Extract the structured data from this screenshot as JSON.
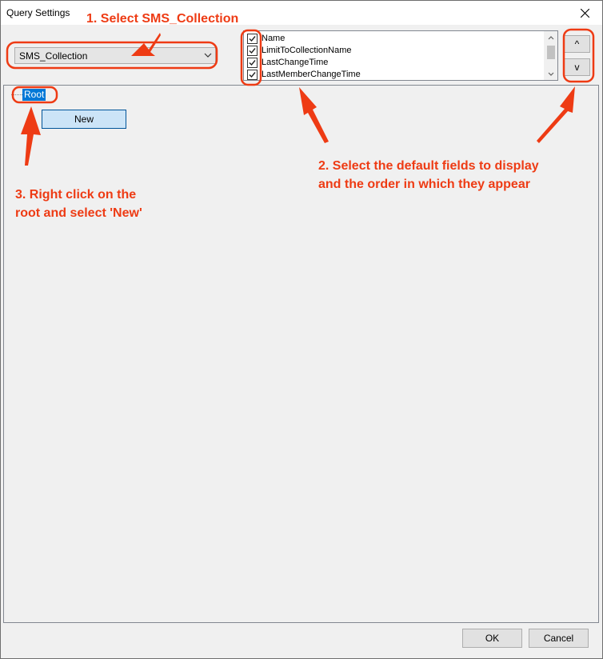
{
  "window": {
    "title": "Query Settings"
  },
  "class_combo": {
    "value": "SMS_Collection"
  },
  "fields": [
    {
      "label": "Name",
      "checked": true
    },
    {
      "label": "LimitToCollectionName",
      "checked": true
    },
    {
      "label": "LastChangeTime",
      "checked": true
    },
    {
      "label": "LastMemberChangeTime",
      "checked": true
    }
  ],
  "order_buttons": {
    "up": "^",
    "down": "v"
  },
  "tree": {
    "root_label": "Root"
  },
  "context_menu": {
    "new_label": "New"
  },
  "footer": {
    "ok_label": "OK",
    "cancel_label": "Cancel"
  },
  "annotations": {
    "step1": "1. Select SMS_Collection",
    "step2_line1": "2. Select the default fields to display",
    "step2_line2": "and the order in which they appear",
    "step3_line1": "3. Right click on the",
    "step3_line2": "root and select 'New'"
  },
  "colors": {
    "annotation": "#ee3b14",
    "selection": "#0078d7",
    "menu_highlight": "#cce4f7"
  }
}
